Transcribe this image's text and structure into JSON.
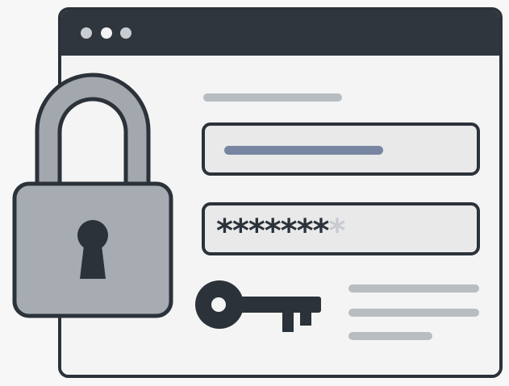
{
  "window": {
    "controls": [
      "window-dot-1",
      "window-dot-2",
      "window-dot-3"
    ]
  },
  "login_form": {
    "password_mask": "*******",
    "password_mask_faded": "*"
  },
  "illustration": {
    "icons": [
      "padlock-icon",
      "keyhole-icon",
      "key-icon"
    ]
  },
  "colors": {
    "frame": "#2b3239",
    "titlebar": "#2f363d",
    "window_background": "#f4f4f4",
    "field_fill": "#e9e9ea",
    "placeholder_line": "#b9bdc2",
    "username_line": "#7785a0",
    "padlock_body": "#a7acb2",
    "padlock_shackle": "#a3a8ae",
    "key": "#2b3239"
  }
}
